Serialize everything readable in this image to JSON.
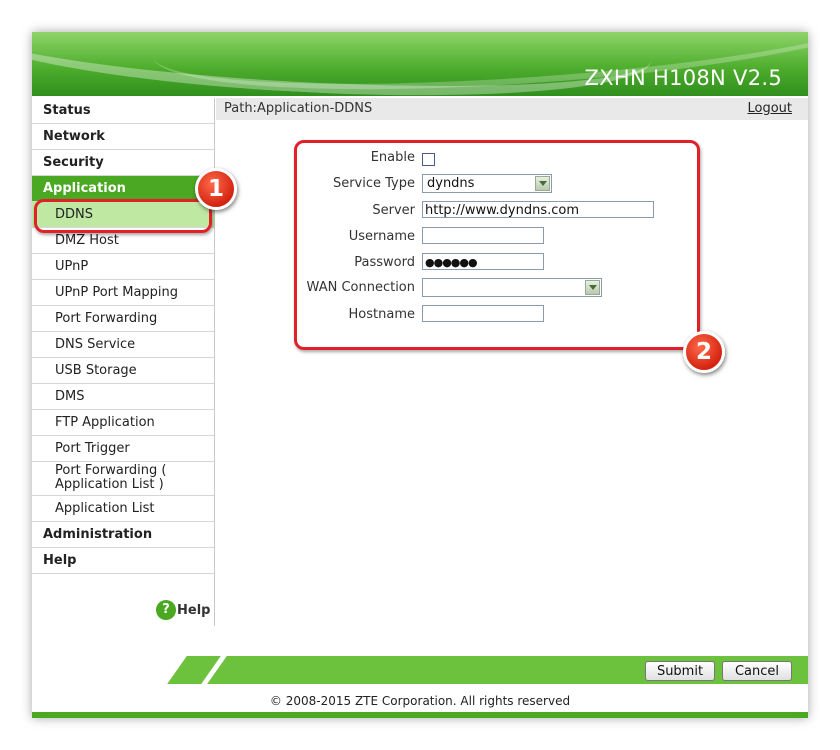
{
  "header": {
    "model": "ZXHN H108N V2.5"
  },
  "sidebar": {
    "top_before": [
      "Status",
      "Network",
      "Security"
    ],
    "application": "Application",
    "sub_items": [
      "DDNS",
      "DMZ Host",
      "UPnP",
      "UPnP Port Mapping",
      "Port Forwarding",
      "DNS Service",
      "USB Storage",
      "DMS",
      "FTP Application",
      "Port Trigger",
      "Port Forwarding ( Application List )",
      "Application List"
    ],
    "top_after": [
      "Administration",
      "Help"
    ],
    "help_label": "Help",
    "help_icon": "?"
  },
  "pathbar": {
    "path": "Path:Application-DDNS",
    "logout": "Logout"
  },
  "form": {
    "enable_label": "Enable",
    "service_type_label": "Service Type",
    "service_type_value": "dyndns",
    "server_label": "Server",
    "server_value": "http://www.dyndns.com",
    "username_label": "Username",
    "username_value": "",
    "password_label": "Password",
    "password_value": "●●●●●●",
    "wan_label": "WAN Connection",
    "wan_value": "",
    "hostname_label": "Hostname",
    "hostname_value": ""
  },
  "annotations": {
    "badge1": "1",
    "badge2": "2",
    "accent_color": "#e0212a"
  },
  "footer": {
    "submit": "Submit",
    "cancel": "Cancel",
    "copyright": "© 2008-2015 ZTE Corporation. All rights reserved"
  },
  "colors": {
    "brand_green": "#4aa822",
    "selected_item": "#bfe9a3"
  }
}
